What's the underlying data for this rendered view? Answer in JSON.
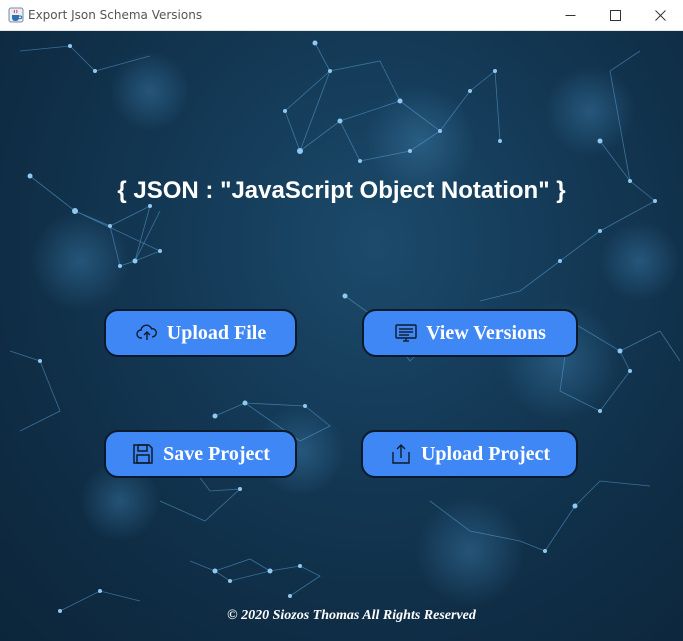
{
  "window": {
    "title": "Export Json Schema Versions",
    "app_icon": "java-cup-icon",
    "controls": [
      "minimize-icon",
      "maximize-icon",
      "close-icon"
    ]
  },
  "main": {
    "headline": "{ JSON : \"JavaScript Object Notation\" }",
    "buttons": {
      "upload_file": {
        "label": "Upload File",
        "icon": "cloud-upload-icon"
      },
      "view_versions": {
        "label": "View Versions",
        "icon": "monitor-icon"
      },
      "save_project": {
        "label": "Save Project",
        "icon": "floppy-disk-icon"
      },
      "upload_project": {
        "label": "Upload Project",
        "icon": "export-icon"
      }
    },
    "footer": "© 2020 Siozos Thomas All Rights Reserved"
  },
  "colors": {
    "background": "#143a57",
    "button": "#3f87f5",
    "button_border": "#0b1a2a",
    "text": "#ffffff"
  }
}
